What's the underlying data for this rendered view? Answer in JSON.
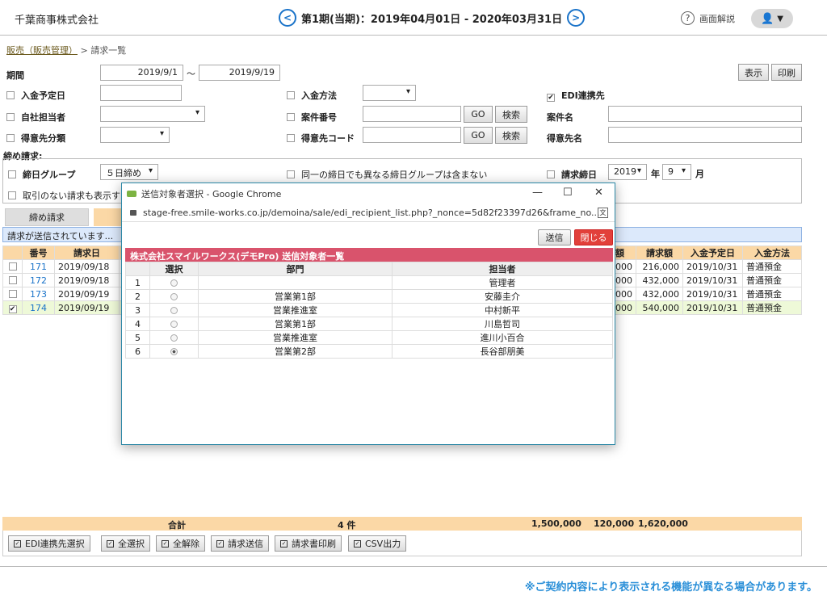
{
  "header": {
    "company": "千葉商事株式会社",
    "period_text": "第1期(当期)：2019年04月01日 - 2020年03月31日",
    "help_label": "画面解説"
  },
  "breadcrumb": {
    "link": "販売（販売管理）",
    "current": "> 請求一覧"
  },
  "filters": {
    "period_label": "期間",
    "date_from": "2019/9/1",
    "tilde": "～",
    "date_to": "2019/9/19",
    "show_button": "表示",
    "print_button": "印刷",
    "due_date_label": "入金予定日",
    "payment_method_label": "入金方法",
    "edi_label": "EDI連携先",
    "staff_label": "自社担当者",
    "case_no_label": "案件番号",
    "case_name_label": "案件名",
    "customer_class_label": "得意先分類",
    "customer_code_label": "得意先コード",
    "customer_name_label": "得意先名",
    "go_label": "GO",
    "search_label": "検索",
    "closing_section": "締め請求:",
    "closing_group_label": "締日グループ",
    "closing_group_value": "５日締め",
    "same_day_label": "同一の締日でも異なる締日グループは含まない",
    "billing_close_label": "請求締日",
    "year_value": "2019",
    "year_unit": "年",
    "month_value": "9",
    "month_unit": "月",
    "no_transaction_label": "取引のない請求も表示する"
  },
  "tabs": {
    "closing": "締め請求"
  },
  "status": "請求が送信されています...",
  "table": {
    "left_headers": [
      "番号",
      "請求日"
    ],
    "right_headers": [
      "額",
      "請求額",
      "入金予定日",
      "入金方法"
    ],
    "rows": [
      {
        "no": "171",
        "date": "2019/09/18",
        "partial": "000",
        "amount": "216,000",
        "due": "2019/10/31",
        "method": "普通預金"
      },
      {
        "no": "172",
        "date": "2019/09/18",
        "partial": "000",
        "amount": "432,000",
        "due": "2019/10/31",
        "method": "普通預金"
      },
      {
        "no": "173",
        "date": "2019/09/19",
        "partial": "000",
        "amount": "432,000",
        "due": "2019/10/31",
        "method": "普通預金"
      },
      {
        "no": "174",
        "date": "2019/09/19",
        "partial": "000",
        "amount": "540,000",
        "due": "2019/10/31",
        "method": "普通預金"
      }
    ]
  },
  "totals": {
    "label": "合計",
    "count": "4 件",
    "subtotal": "1,500,000",
    "tax": "120,000",
    "total": "1,620,000"
  },
  "actions": {
    "edi_select": "EDI連携先選択",
    "select_all": "全選択",
    "deselect_all": "全解除",
    "send_invoice": "請求送信",
    "print_invoice": "請求書印刷",
    "csv": "CSV出力"
  },
  "note": "※ご契約内容により表示される機能が異なる場合があります。",
  "popup": {
    "title": "送信対象者選択 - Google Chrome",
    "url": "stage-free.smile-works.co.jp/demoina/sale/edi_recipient_list.php?_nonce=5d82f23397d26&frame_no...",
    "send_button": "送信",
    "close_button": "閉じる",
    "table_title": "株式会社スマイルワークス(デモPro) 送信対象者一覧",
    "headers": {
      "select": "選択",
      "department": "部門",
      "person": "担当者"
    },
    "rows": [
      {
        "no": "1",
        "department": "",
        "person": "管理者",
        "selected": false
      },
      {
        "no": "2",
        "department": "営業第1部",
        "person": "安藤圭介",
        "selected": false
      },
      {
        "no": "3",
        "department": "営業推進室",
        "person": "中村新平",
        "selected": false
      },
      {
        "no": "4",
        "department": "営業第1部",
        "person": "川島哲司",
        "selected": false
      },
      {
        "no": "5",
        "department": "営業推進室",
        "person": "進川小百合",
        "selected": false
      },
      {
        "no": "6",
        "department": "営業第2部",
        "person": "長谷部朋美",
        "selected": true
      }
    ]
  }
}
